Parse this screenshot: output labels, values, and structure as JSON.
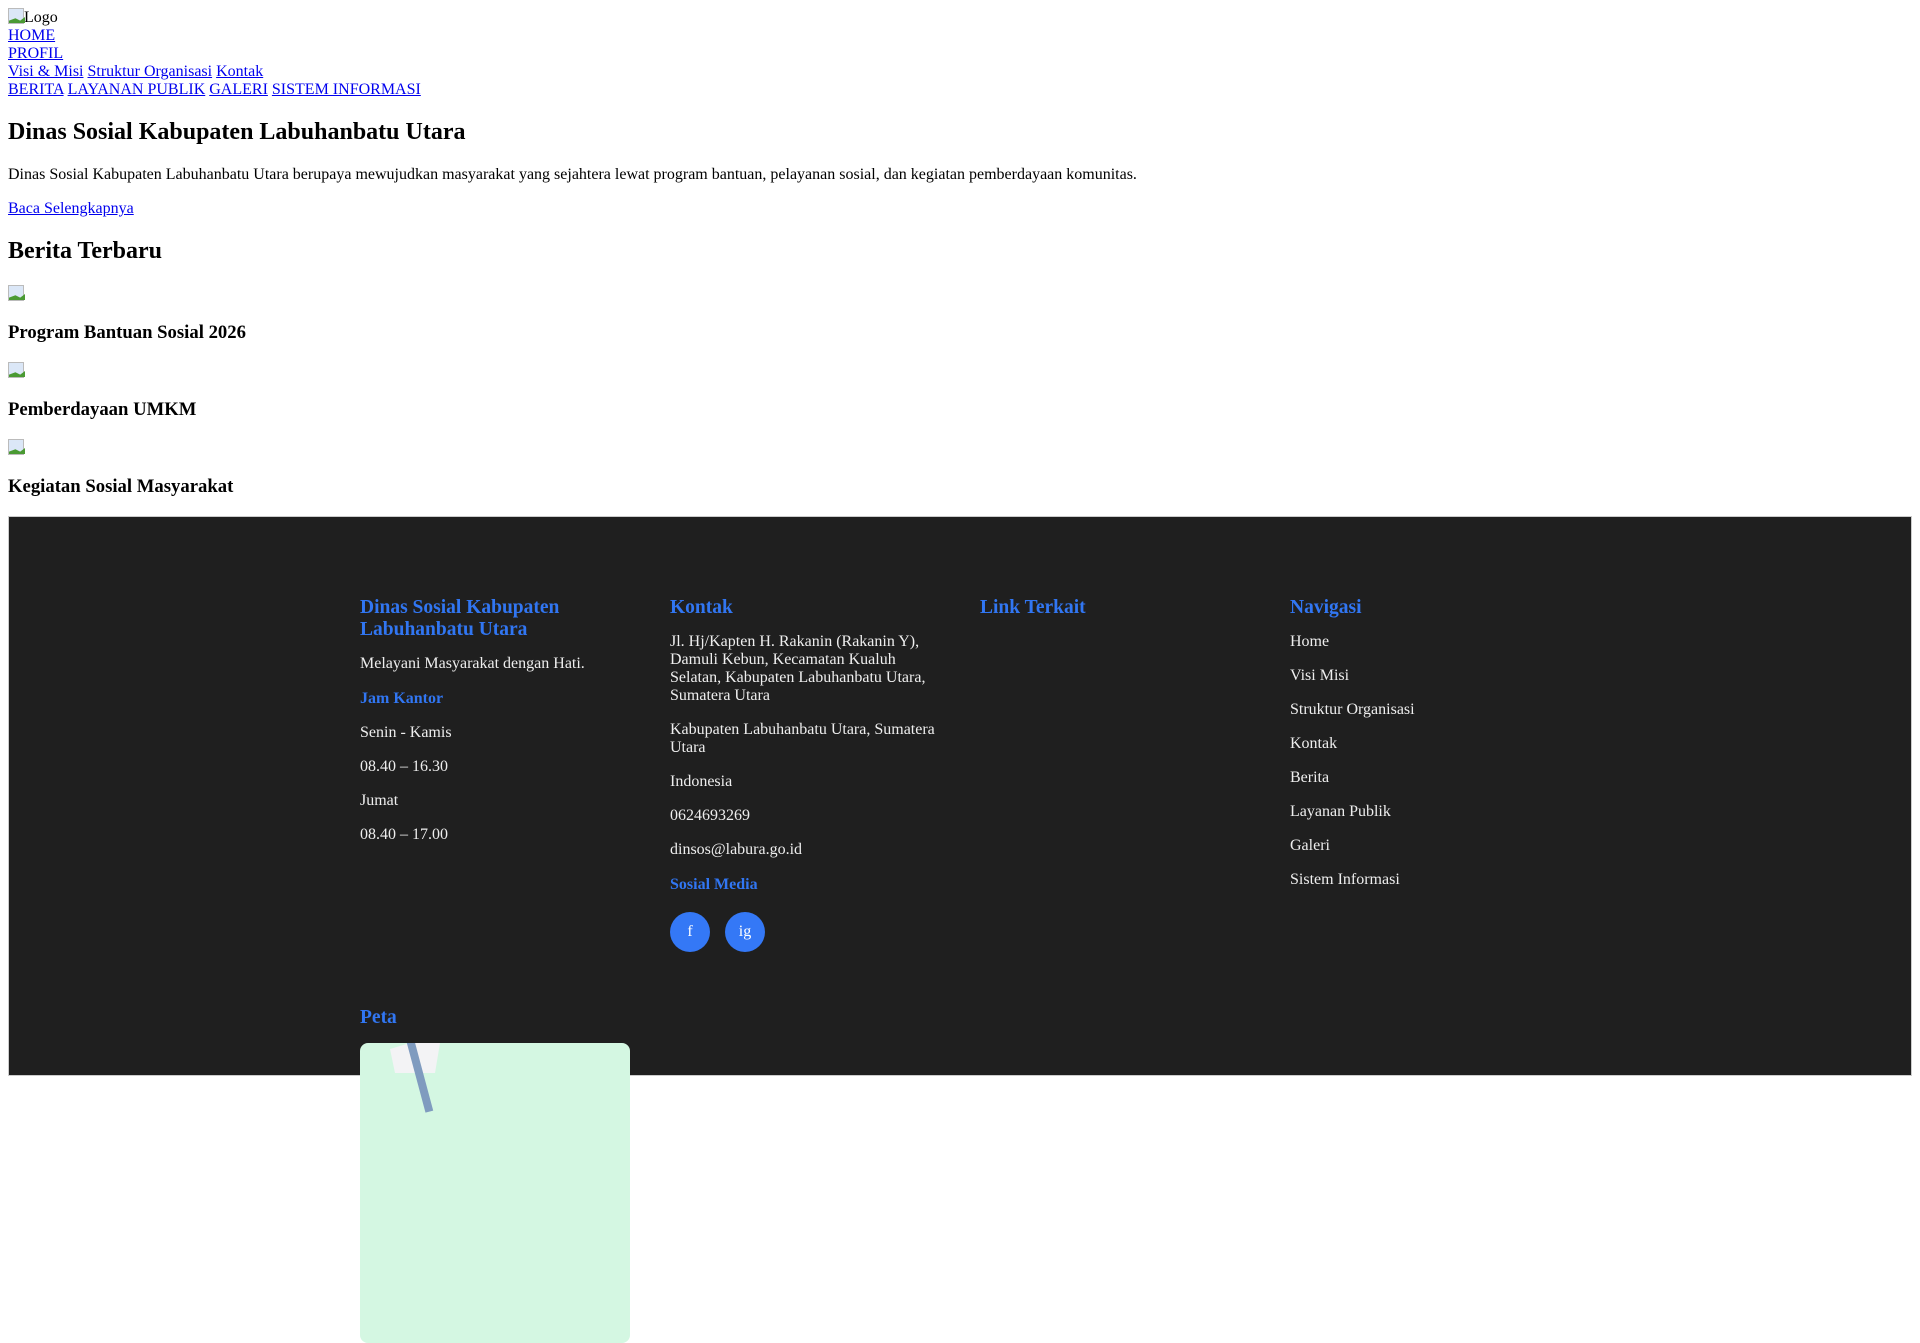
{
  "header": {
    "logo_alt": "Logo",
    "nav": {
      "home": "HOME",
      "profil": "PROFIL",
      "profil_sub": [
        "Visi & Misi",
        "Struktur Organisasi",
        "Kontak"
      ],
      "main": [
        "BERITA",
        "LAYANAN PUBLIK",
        "GALERI",
        "SISTEM INFORMASI"
      ]
    }
  },
  "hero": {
    "title": "Dinas Sosial Kabupaten Labuhanbatu Utara",
    "description": "Dinas Sosial Kabupaten Labuhanbatu Utara berupaya mewujudkan masyarakat yang sejahtera lewat program bantuan, pelayanan sosial, dan kegiatan pemberdayaan komunitas.",
    "read_more": "Baca Selengkapnya"
  },
  "news": {
    "title": "Berita Terbaru",
    "items": [
      "Program Bantuan Sosial 2026",
      "Pemberdayaan UMKM",
      "Kegiatan Sosial Masyarakat"
    ]
  },
  "footer": {
    "about": {
      "title": "Dinas Sosial Kabupaten Labuhanbatu Utara",
      "tagline": "Melayani Masyarakat dengan Hati.",
      "hours_title": "Jam Kantor",
      "hours": [
        "Senin - Kamis",
        "08.40 – 16.30",
        "Jumat",
        "08.40 – 17.00"
      ]
    },
    "contact": {
      "title": "Kontak",
      "address": "Jl. Hj/Kapten H. Rakanin (Rakanin Y), Damuli Kebun, Kecamatan Kualuh Selatan, Kabupaten Labuhanbatu Utara, Sumatera Utara",
      "region": "Kabupaten Labuhanbatu Utara, Sumatera Utara",
      "country": "Indonesia",
      "phone": "0624693269",
      "email": "dinsos@labura.go.id",
      "social_title": "Sosial Media",
      "social": [
        "f",
        "ig"
      ]
    },
    "links": {
      "title": "Link Terkait"
    },
    "nav": {
      "title": "Navigasi",
      "items": [
        "Home",
        "Visi Misi",
        "Struktur Organisasi",
        "Kontak",
        "Berita",
        "Layanan Publik",
        "Galeri",
        "Sistem Informasi"
      ]
    },
    "map": {
      "title": "Peta"
    }
  },
  "colors": {
    "accent": "#3176f2",
    "footer_bg": "#1f1f1f",
    "social": "#3478f6"
  }
}
